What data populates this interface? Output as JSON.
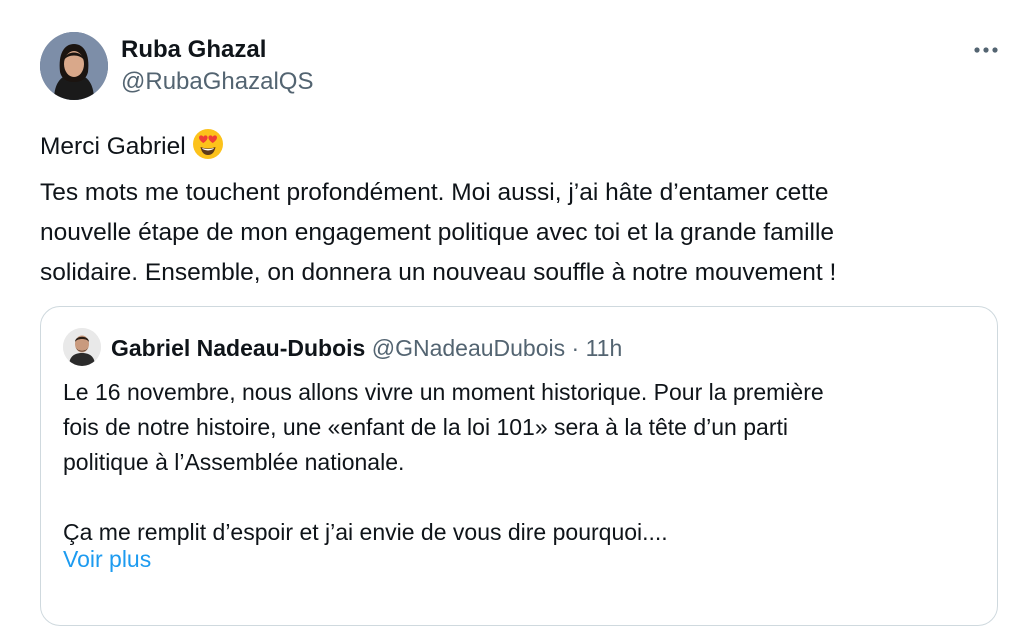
{
  "tweet": {
    "author_name": "Ruba Ghazal",
    "author_handle": "@RubaGhazalQS",
    "more_icon": "more-horizontal-icon",
    "lines": [
      "Merci Gabriel",
      "Tes mots me touchent profondément. Moi aussi, j’ai hâte d’entamer cette",
      "nouvelle étape de mon engagement politique avec toi et la grande famille",
      "solidaire. Ensemble, on donnera un nouveau souffle à notre mouvement !"
    ],
    "emoji": "heart-eyes-emoji"
  },
  "quoted_tweet": {
    "author_name": "Gabriel Nadeau-Dubois",
    "author_handle": "@GNadeauDubois",
    "separator": "·",
    "time": "11h",
    "lines": [
      "Le 16 novembre, nous allons vivre un moment historique. Pour la première",
      "fois de notre histoire, une «enfant de la loi 101» sera à la tête d’un parti",
      "politique à l’Assemblée nationale.",
      "Ça me remplit d’espoir et j’ai envie de vous dire pourquoi...."
    ],
    "show_more": "Voir plus"
  },
  "colors": {
    "text": "#0f1419",
    "secondary": "#536471",
    "link": "#1d9bf0",
    "border": "#cfd9de"
  }
}
